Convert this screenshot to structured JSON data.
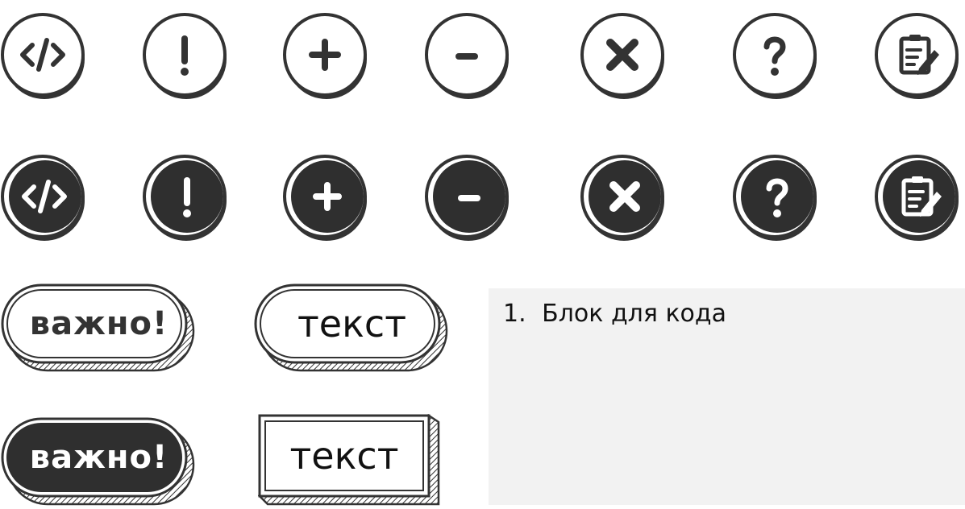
{
  "colors": {
    "ink": "#333333",
    "fill_dark": "#2f2f2f",
    "paper": "#ffffff",
    "code_bg": "#f2f2f2"
  },
  "icons_outline": [
    {
      "name": "code-icon"
    },
    {
      "name": "exclamation-icon"
    },
    {
      "name": "plus-icon"
    },
    {
      "name": "minus-icon"
    },
    {
      "name": "close-icon"
    },
    {
      "name": "question-icon"
    },
    {
      "name": "notepad-edit-icon"
    }
  ],
  "icons_filled": [
    {
      "name": "code-icon"
    },
    {
      "name": "exclamation-icon"
    },
    {
      "name": "plus-icon"
    },
    {
      "name": "minus-icon"
    },
    {
      "name": "close-icon"
    },
    {
      "name": "question-icon"
    },
    {
      "name": "notepad-edit-icon"
    }
  ],
  "badges": {
    "important_outline": "важно!",
    "text_outline": "текст",
    "important_filled": "важно!",
    "text_box": "текст"
  },
  "code_block": {
    "line_number": "1.",
    "text": "Блок для кода"
  }
}
